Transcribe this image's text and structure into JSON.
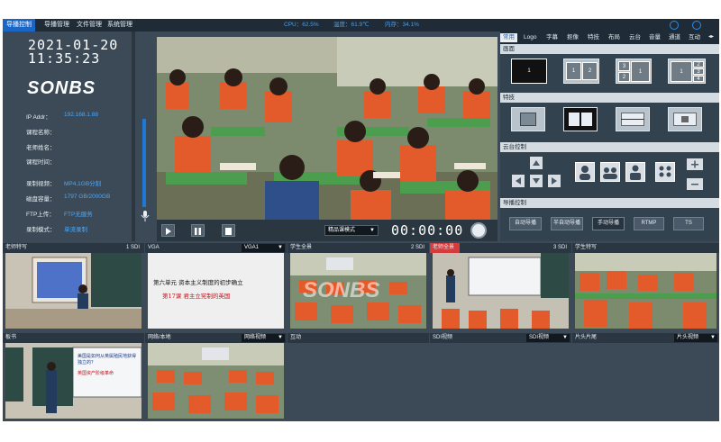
{
  "menu": [
    "导播控制",
    "导播管理",
    "文件管理",
    "系统管理"
  ],
  "status": {
    "cpu": "CPU：62.5%",
    "temp": "温度：61.9℃",
    "mem": "内存：34.1%"
  },
  "clock": {
    "date": "2021-01-20",
    "time": "11:35:23"
  },
  "brand": "SONBS",
  "info": [
    {
      "label": "IP Addr：",
      "value": "192.168.1.88"
    },
    {
      "label": "课程名称：",
      "value": ""
    },
    {
      "label": "老师姓名：",
      "value": ""
    },
    {
      "label": "课程时间：",
      "value": ""
    },
    {
      "label": "录制视频：",
      "value": "MP4,1GB分割"
    },
    {
      "label": "磁盘容量：",
      "value": "1797 GB/2000GB"
    },
    {
      "label": "FTP上传：",
      "value": "FTP无服务"
    },
    {
      "label": "录制模式：",
      "value": "单流录制"
    }
  ],
  "player": {
    "mode": "精品课模式",
    "timecode": "00:00:00"
  },
  "tabs": [
    "常用",
    "Logo",
    "字幕",
    "抠像",
    "特技",
    "布局",
    "云台",
    "音量",
    "通道",
    "互动"
  ],
  "sections": {
    "layout": "画面",
    "fx": "特技",
    "ptz": "云台控制",
    "director": "导播控制"
  },
  "layout_nums": {
    "a": "1",
    "b1": "1",
    "b2": "2",
    "c1": "3",
    "c2": "2",
    "c3": "1",
    "d1": "1",
    "d2": "2",
    "d3": "3",
    "d4": "4"
  },
  "director_buttons": [
    "自动导播",
    "半自动导播",
    "手动导播",
    "RTMP",
    "TS"
  ],
  "thumbs": [
    {
      "title": "老师特写",
      "src": "1 SDI"
    },
    {
      "title": "VGA",
      "src": "VGA1"
    },
    {
      "title": "学生全景",
      "src": "2 SDI"
    },
    {
      "title": "老师全景",
      "src": "3 SDI"
    },
    {
      "title": "学生特写",
      "src": ""
    },
    {
      "title": "板书",
      "src": ""
    },
    {
      "title": "网络/本地",
      "src": "网络视频"
    },
    {
      "title": "互动",
      "src": ""
    },
    {
      "title": "SDI视频",
      "src": "SDI视频"
    },
    {
      "title": "片头片尾",
      "src": "片头视频"
    }
  ],
  "vga": {
    "line1": "第六单元   资本主义制度的初步确立",
    "line2": "第17课  君主立宪制的英国"
  },
  "slide1": {
    "text": "美国是如何从英属殖民地获得独立的？"
  },
  "slide2": {
    "text": "英国资产阶级革命"
  }
}
